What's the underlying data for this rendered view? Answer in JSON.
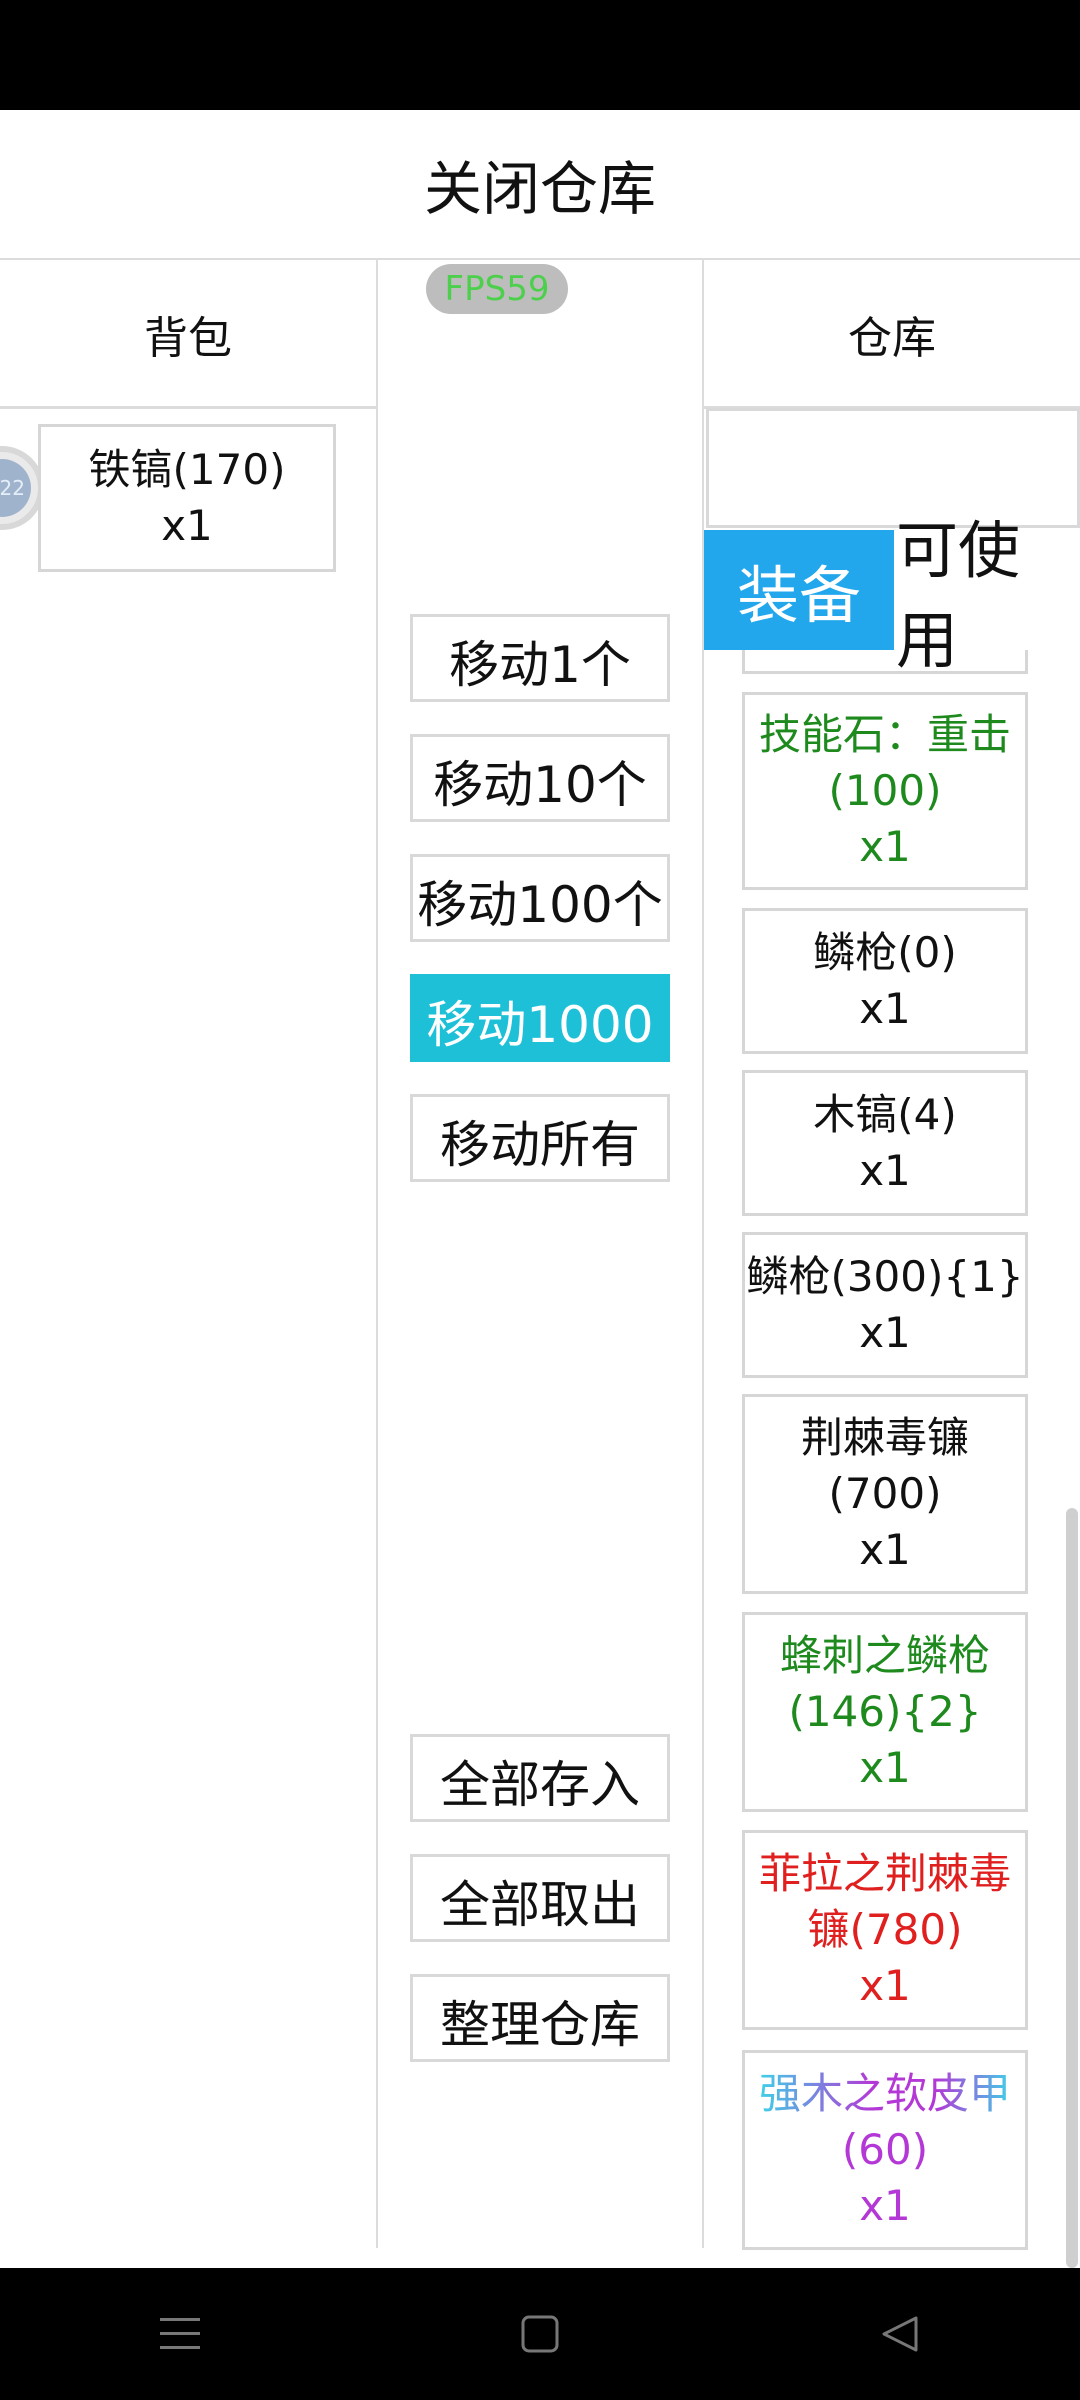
{
  "title": "关闭仓库",
  "fps": "FPS59",
  "backpack": {
    "header": "背包",
    "avatar_text": "22",
    "items": [
      {
        "name": "铁镐(170)",
        "qty": "x1"
      }
    ]
  },
  "actions": {
    "move_1": "移动1个",
    "move_10": "移动10个",
    "move_100": "移动100个",
    "move_1000": "移动1000",
    "move_all": "移动所有",
    "deposit_all": "全部存入",
    "withdraw_all": "全部取出",
    "sort": "整理仓库"
  },
  "warehouse": {
    "header": "仓库",
    "search_value": "",
    "tabs": [
      "装备",
      "可使用"
    ],
    "items": [
      {
        "line1": "技能石：重击",
        "line2": "(100)",
        "qty": "x1",
        "color": "#1e8a1e"
      },
      {
        "line1": "鳞枪(0)",
        "qty": "x1",
        "color": "#111111"
      },
      {
        "line1": "木镐(4)",
        "qty": "x1",
        "color": "#111111"
      },
      {
        "line1": "鳞枪(300){1}",
        "qty": "x1",
        "color": "#111111"
      },
      {
        "line1": "荆棘毒镰",
        "line2": "(700)",
        "qty": "x1",
        "color": "#111111"
      },
      {
        "line1": "蜂刺之鳞枪",
        "line2": "(146){2}",
        "qty": "x1",
        "color": "#1e8a1e"
      },
      {
        "line1": "菲拉之荆棘毒",
        "line2": "镰(780)",
        "qty": "x1",
        "color": "#e01f1f"
      },
      {
        "line1": "强木之软皮甲",
        "line2": "(60)",
        "qty": "x1",
        "color": "#b438d6"
      }
    ]
  },
  "nav": [
    "menu-icon",
    "home-square-icon",
    "back-triangle-icon"
  ]
}
